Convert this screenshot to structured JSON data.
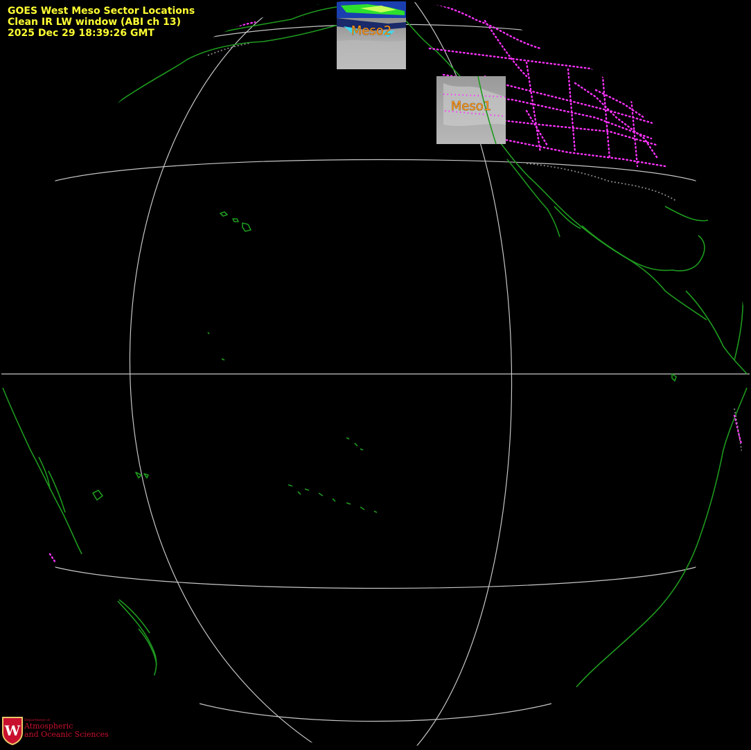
{
  "header": {
    "line1": "GOES West Meso Sector Locations",
    "line2": "Clean IR LW window (ABI ch 13)",
    "line3": "2025 Dec 29  18:39:26 GMT"
  },
  "sectors": {
    "meso1": {
      "label": "Meso1"
    },
    "meso2": {
      "label": "Meso2"
    }
  },
  "logo": {
    "dept": "Department of",
    "line1": "Atmospheric",
    "line2": "and Oceanic Sciences",
    "crest_letter": "W"
  },
  "colors": {
    "background": "#000000",
    "coastline": "#1e9a1e",
    "borders": "#ff33ff",
    "grid": "#c8c8c8",
    "header_text": "#ffff33",
    "meso_label": "#ff9a1a",
    "logo": "#c8102e"
  }
}
